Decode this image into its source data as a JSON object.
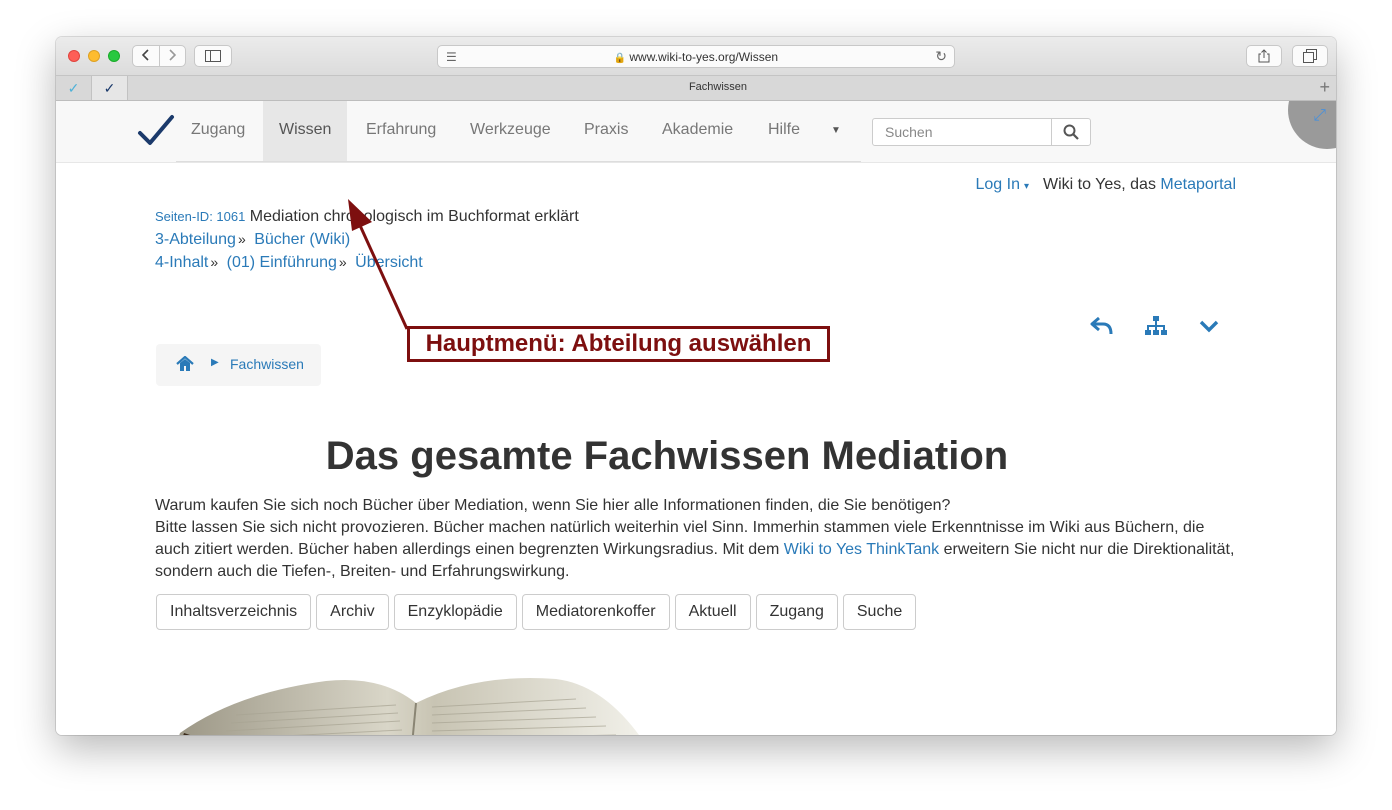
{
  "browser": {
    "url": "www.wiki-to-yes.org/Wissen",
    "tab_title": "Fachwissen",
    "pinned_tabs": [
      "✓",
      "✓"
    ]
  },
  "nav": {
    "items": [
      "Zugang",
      "Wissen",
      "Erfahrung",
      "Werkzeuge",
      "Praxis",
      "Akademie",
      "Hilfe"
    ],
    "active": "Wissen",
    "search_placeholder": "Suchen"
  },
  "header": {
    "login": "Log In",
    "site_text": "Wiki to Yes, das",
    "portal_link": "Metaportal"
  },
  "meta": {
    "page_id_label": "Seiten-ID: 1061",
    "page_title": "Mediation chronologisch im Buchformat erklärt",
    "line2": [
      "3-Abteilung",
      "Bücher (Wiki)"
    ],
    "line3": [
      "4-Inhalt",
      "(01) Einführung",
      "Übersicht"
    ],
    "separator": "»"
  },
  "breadcrumb": {
    "current": "Fachwissen"
  },
  "annotation": {
    "text": "Hauptmenü: Abteilung auswählen"
  },
  "main": {
    "heading": "Das gesamte Fachwissen Mediation",
    "line1": "Warum kaufen Sie sich noch Bücher über Mediation, wenn Sie hier alle Informationen finden, die Sie benötigen?",
    "line2_before": "Bitte lassen Sie sich nicht provozieren. Bücher machen natürlich weiterhin viel Sinn. Immerhin stammen viele Erkenntnisse im Wiki aus Büchern, die auch zitiert werden. Bücher haben allerdings einen begrenzten Wirkungsradius. Mit dem",
    "line2_link": "Wiki to Yes ThinkTank",
    "line2_after": "erweitern Sie nicht nur die Direktionalität, sondern auch die Tiefen-, Breiten- und Erfahrungswirkung.",
    "buttons": [
      "Inhaltsverzeichnis",
      "Archiv",
      "Enzyklopädie",
      "Mediatorenkoffer",
      "Aktuell",
      "Zugang",
      "Suche"
    ]
  },
  "colors": {
    "link": "#2a7ab8",
    "annotation": "#7d0f0f",
    "navbar_bg": "#f8f8f8"
  }
}
